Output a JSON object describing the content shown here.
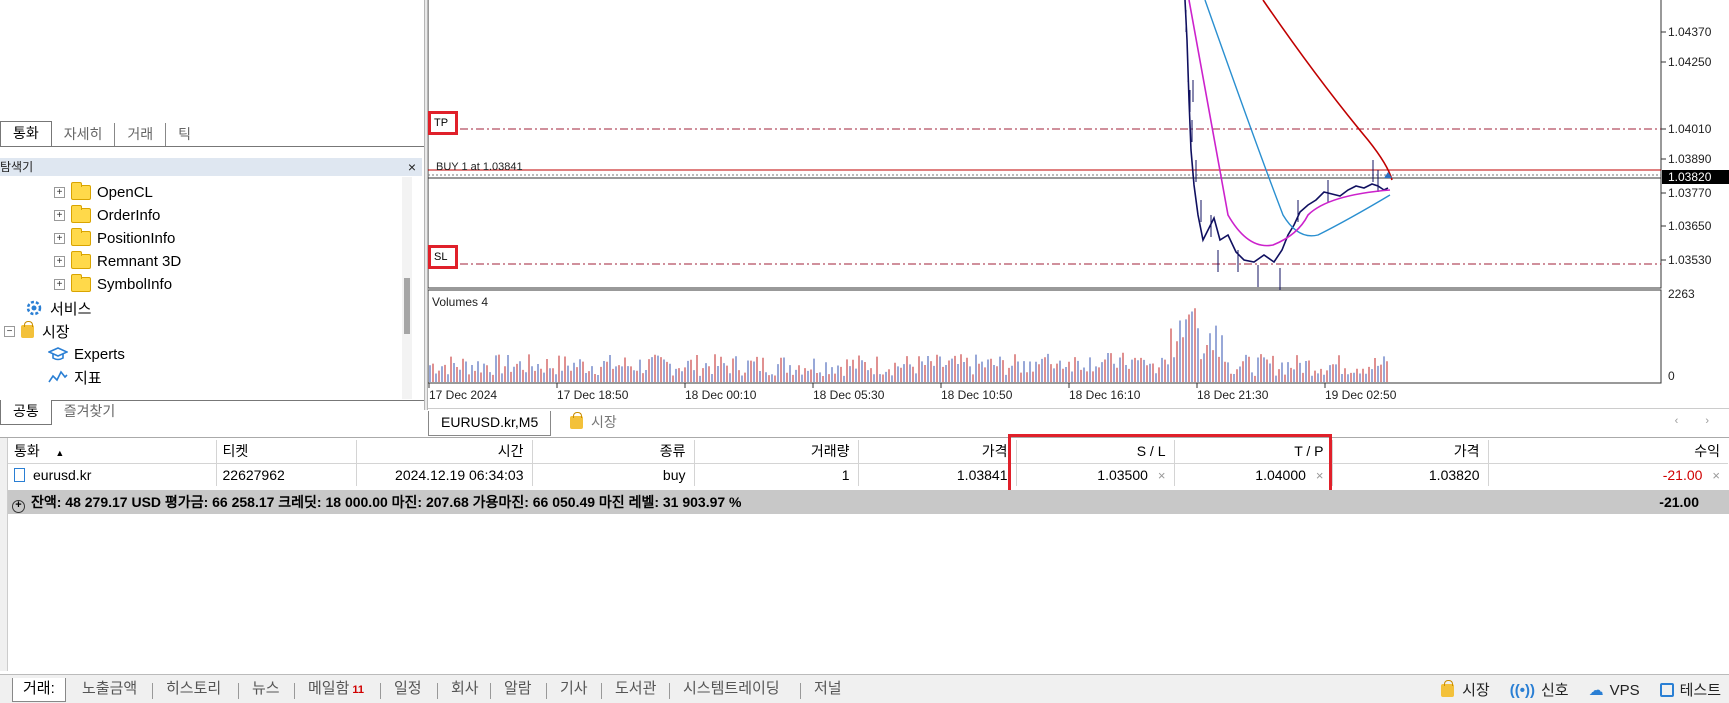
{
  "navigator": {
    "top_tabs": [
      "통화",
      "자세히",
      "거래",
      "틱"
    ],
    "title": "탐색기",
    "close_glyph": "×",
    "tree": [
      {
        "label": "OpenCL",
        "type": "folder"
      },
      {
        "label": "OrderInfo",
        "type": "folder"
      },
      {
        "label": "PositionInfo",
        "type": "folder"
      },
      {
        "label": "Remnant 3D",
        "type": "folder"
      },
      {
        "label": "SymbolInfo",
        "type": "folder"
      },
      {
        "label": "서비스",
        "type": "services"
      },
      {
        "label": "시장",
        "type": "market"
      },
      {
        "label": "Experts",
        "type": "experts"
      },
      {
        "label": "지표",
        "type": "indicators"
      }
    ],
    "bottom_tabs": [
      "공통",
      "즐겨찾기"
    ]
  },
  "chart": {
    "trade_label": "BUY 1 at 1.03841",
    "tp_label": "TP",
    "sl_label": "SL",
    "volumes_label": "Volumes 4",
    "price_ticks": [
      "1.04370",
      "1.04250",
      "1.04010",
      "1.03890",
      "1.03770",
      "1.03650",
      "1.03530"
    ],
    "current_price": "1.03820",
    "volume_ticks": [
      "2263",
      "0"
    ],
    "time_ticks": [
      "17 Dec 2024",
      "17 Dec 18:50",
      "18 Dec 00:10",
      "18 Dec 05:30",
      "18 Dec 10:50",
      "18 Dec 16:10",
      "18 Dec 21:30",
      "19 Dec 02:50"
    ],
    "colors": {
      "buy_line": "#c00000",
      "tp_sl_line": "#a0203a",
      "ma_red": "#c00000",
      "ma_blue": "#2a8fd0",
      "ma_magenta": "#cc22cc",
      "price_line": "#101060",
      "vol_red": "#c02020",
      "vol_blue": "#3050b0"
    },
    "tabs": [
      {
        "label": "EURUSD.kr,M5",
        "active": true
      },
      {
        "label": "시장",
        "active": false
      }
    ],
    "scroll_glyphs": "‹ ›"
  },
  "trade_table": {
    "columns": [
      "통화",
      "티켓",
      "시간",
      "종류",
      "거래량",
      "가격",
      "S / L",
      "T / P",
      "가격",
      "수익"
    ],
    "sort_glyph": "▲",
    "rows": [
      {
        "symbol": "eurusd.kr",
        "ticket": "22627962",
        "time": "2024.12.19 06:34:03",
        "type": "buy",
        "volume": "1",
        "open_price": "1.03841",
        "sl": "1.03500",
        "tp": "1.04000",
        "current_price": "1.03820",
        "profit": "-21.00"
      }
    ],
    "remove_glyph": "×",
    "summary": {
      "expand_glyph": "+",
      "text": "잔액: 48 279.17 USD  평가금: 66 258.17  크레딧: 18 000.00  마진: 207.68  가용마진: 66 050.49  마진 레벨: 31 903.97 %",
      "total": "-21.00"
    }
  },
  "terminal_tabs": [
    {
      "label": "거래:",
      "active": true
    },
    {
      "label": "노출금액"
    },
    {
      "label": "히스토리"
    },
    {
      "label": "뉴스"
    },
    {
      "label": "메일함",
      "count": "11"
    },
    {
      "label": "일정"
    },
    {
      "label": "회사"
    },
    {
      "label": "알람"
    },
    {
      "label": "기사"
    },
    {
      "label": "도서관"
    },
    {
      "label": "시스템트레이딩"
    },
    {
      "label": "저널"
    }
  ],
  "status": {
    "market": "시장",
    "signals": "신호",
    "vps": "VPS",
    "tester": "테스트"
  }
}
